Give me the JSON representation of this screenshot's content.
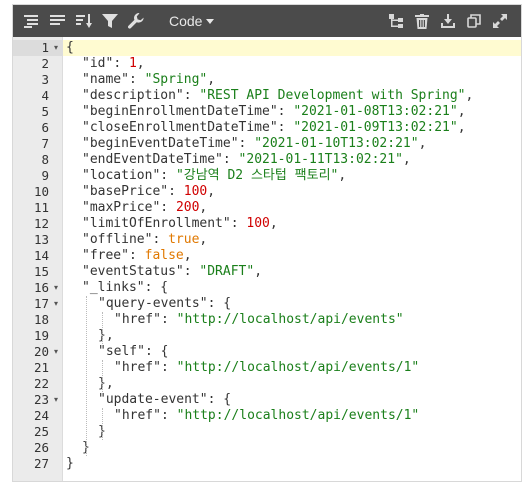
{
  "toolbar": {
    "mode_label": "Code",
    "left_icons": [
      "format-icon",
      "compact-icon",
      "sort-icon",
      "filter-icon",
      "repair-icon"
    ],
    "right_icons": [
      "transform-icon",
      "delete-icon",
      "download-icon",
      "copy-icon",
      "fullscreen-icon"
    ]
  },
  "colors": {
    "toolbar_bg": "#4b4b4b",
    "key": "#333333",
    "string": "#1a7f1a",
    "number": "#d00000",
    "boolean": "#e07800",
    "active_line": "#fffbd1",
    "gutter_bg": "#ebebeb"
  },
  "editor": {
    "active_line": 1,
    "lines": [
      {
        "num": "1",
        "fold": true,
        "indent": 0,
        "tokens": [
          {
            "t": "p",
            "v": "{"
          }
        ]
      },
      {
        "num": "2",
        "fold": false,
        "indent": 1,
        "tokens": [
          {
            "t": "k",
            "v": "\"id\""
          },
          {
            "t": "p",
            "v": ": "
          },
          {
            "t": "n",
            "v": "1"
          },
          {
            "t": "p",
            "v": ","
          }
        ]
      },
      {
        "num": "3",
        "fold": false,
        "indent": 1,
        "tokens": [
          {
            "t": "k",
            "v": "\"name\""
          },
          {
            "t": "p",
            "v": ": "
          },
          {
            "t": "s",
            "v": "\"Spring\""
          },
          {
            "t": "p",
            "v": ","
          }
        ]
      },
      {
        "num": "4",
        "fold": false,
        "indent": 1,
        "tokens": [
          {
            "t": "k",
            "v": "\"description\""
          },
          {
            "t": "p",
            "v": ": "
          },
          {
            "t": "s",
            "v": "\"REST API Development with Spring\""
          },
          {
            "t": "p",
            "v": ","
          }
        ]
      },
      {
        "num": "5",
        "fold": false,
        "indent": 1,
        "tokens": [
          {
            "t": "k",
            "v": "\"beginEnrollmentDateTime\""
          },
          {
            "t": "p",
            "v": ": "
          },
          {
            "t": "s",
            "v": "\"2021-01-08T13:02:21\""
          },
          {
            "t": "p",
            "v": ","
          }
        ]
      },
      {
        "num": "6",
        "fold": false,
        "indent": 1,
        "tokens": [
          {
            "t": "k",
            "v": "\"closeEnrollmentDateTime\""
          },
          {
            "t": "p",
            "v": ": "
          },
          {
            "t": "s",
            "v": "\"2021-01-09T13:02:21\""
          },
          {
            "t": "p",
            "v": ","
          }
        ]
      },
      {
        "num": "7",
        "fold": false,
        "indent": 1,
        "tokens": [
          {
            "t": "k",
            "v": "\"beginEventDateTime\""
          },
          {
            "t": "p",
            "v": ": "
          },
          {
            "t": "s",
            "v": "\"2021-01-10T13:02:21\""
          },
          {
            "t": "p",
            "v": ","
          }
        ]
      },
      {
        "num": "8",
        "fold": false,
        "indent": 1,
        "tokens": [
          {
            "t": "k",
            "v": "\"endEventDateTime\""
          },
          {
            "t": "p",
            "v": ": "
          },
          {
            "t": "s",
            "v": "\"2021-01-11T13:02:21\""
          },
          {
            "t": "p",
            "v": ","
          }
        ]
      },
      {
        "num": "9",
        "fold": false,
        "indent": 1,
        "tokens": [
          {
            "t": "k",
            "v": "\"location\""
          },
          {
            "t": "p",
            "v": ": "
          },
          {
            "t": "s",
            "v": "\"강남역 D2 스타텁 팩토리\""
          },
          {
            "t": "p",
            "v": ","
          }
        ]
      },
      {
        "num": "10",
        "fold": false,
        "indent": 1,
        "tokens": [
          {
            "t": "k",
            "v": "\"basePrice\""
          },
          {
            "t": "p",
            "v": ": "
          },
          {
            "t": "n",
            "v": "100"
          },
          {
            "t": "p",
            "v": ","
          }
        ]
      },
      {
        "num": "11",
        "fold": false,
        "indent": 1,
        "tokens": [
          {
            "t": "k",
            "v": "\"maxPrice\""
          },
          {
            "t": "p",
            "v": ": "
          },
          {
            "t": "n",
            "v": "200"
          },
          {
            "t": "p",
            "v": ","
          }
        ]
      },
      {
        "num": "12",
        "fold": false,
        "indent": 1,
        "tokens": [
          {
            "t": "k",
            "v": "\"limitOfEnrollment\""
          },
          {
            "t": "p",
            "v": ": "
          },
          {
            "t": "n",
            "v": "100"
          },
          {
            "t": "p",
            "v": ","
          }
        ]
      },
      {
        "num": "13",
        "fold": false,
        "indent": 1,
        "tokens": [
          {
            "t": "k",
            "v": "\"offline\""
          },
          {
            "t": "p",
            "v": ": "
          },
          {
            "t": "b",
            "v": "true"
          },
          {
            "t": "p",
            "v": ","
          }
        ]
      },
      {
        "num": "14",
        "fold": false,
        "indent": 1,
        "tokens": [
          {
            "t": "k",
            "v": "\"free\""
          },
          {
            "t": "p",
            "v": ": "
          },
          {
            "t": "b",
            "v": "false"
          },
          {
            "t": "p",
            "v": ","
          }
        ]
      },
      {
        "num": "15",
        "fold": false,
        "indent": 1,
        "tokens": [
          {
            "t": "k",
            "v": "\"eventStatus\""
          },
          {
            "t": "p",
            "v": ": "
          },
          {
            "t": "s",
            "v": "\"DRAFT\""
          },
          {
            "t": "p",
            "v": ","
          }
        ]
      },
      {
        "num": "16",
        "fold": true,
        "indent": 1,
        "tokens": [
          {
            "t": "k",
            "v": "\"_links\""
          },
          {
            "t": "p",
            "v": ": {"
          }
        ]
      },
      {
        "num": "17",
        "fold": true,
        "indent": 2,
        "tokens": [
          {
            "t": "k",
            "v": "\"query-events\""
          },
          {
            "t": "p",
            "v": ": {"
          }
        ]
      },
      {
        "num": "18",
        "fold": false,
        "indent": 3,
        "tokens": [
          {
            "t": "k",
            "v": "\"href\""
          },
          {
            "t": "p",
            "v": ": "
          },
          {
            "t": "s",
            "v": "\"http://localhost/api/events\""
          }
        ]
      },
      {
        "num": "19",
        "fold": false,
        "indent": 2,
        "tokens": [
          {
            "t": "p",
            "v": "},"
          }
        ]
      },
      {
        "num": "20",
        "fold": true,
        "indent": 2,
        "tokens": [
          {
            "t": "k",
            "v": "\"self\""
          },
          {
            "t": "p",
            "v": ": {"
          }
        ]
      },
      {
        "num": "21",
        "fold": false,
        "indent": 3,
        "tokens": [
          {
            "t": "k",
            "v": "\"href\""
          },
          {
            "t": "p",
            "v": ": "
          },
          {
            "t": "s",
            "v": "\"http://localhost/api/events/1\""
          }
        ]
      },
      {
        "num": "22",
        "fold": false,
        "indent": 2,
        "tokens": [
          {
            "t": "p",
            "v": "},"
          }
        ]
      },
      {
        "num": "23",
        "fold": true,
        "indent": 2,
        "tokens": [
          {
            "t": "k",
            "v": "\"update-event\""
          },
          {
            "t": "p",
            "v": ": {"
          }
        ]
      },
      {
        "num": "24",
        "fold": false,
        "indent": 3,
        "tokens": [
          {
            "t": "k",
            "v": "\"href\""
          },
          {
            "t": "p",
            "v": ": "
          },
          {
            "t": "s",
            "v": "\"http://localhost/api/events/1\""
          }
        ]
      },
      {
        "num": "25",
        "fold": false,
        "indent": 2,
        "tokens": [
          {
            "t": "p",
            "v": "}"
          }
        ]
      },
      {
        "num": "26",
        "fold": false,
        "indent": 1,
        "tokens": [
          {
            "t": "p",
            "v": "}"
          }
        ]
      },
      {
        "num": "27",
        "fold": false,
        "indent": 0,
        "tokens": [
          {
            "t": "p",
            "v": "}"
          }
        ]
      }
    ]
  }
}
